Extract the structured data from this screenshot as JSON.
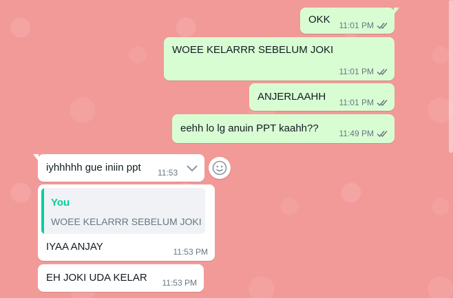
{
  "theme": {
    "wallpaper": "#f29a98",
    "outgoing_bubble": "#d9fdd3",
    "incoming_bubble": "#ffffff",
    "quote_accent": "#06cf9c",
    "tick_color": "#667781"
  },
  "messages": [
    {
      "direction": "outgoing",
      "text": "OKK",
      "time": "11:01 PM",
      "status": "double-check-icon"
    },
    {
      "direction": "outgoing",
      "text": "WOEE KELARRR SEBELUM JOKI",
      "time": "11:01 PM",
      "status": "double-check-icon"
    },
    {
      "direction": "outgoing",
      "text": "ANJERLAAHH",
      "time": "11:01 PM",
      "status": "double-check-icon"
    },
    {
      "direction": "outgoing",
      "text": "eehh lo lg anuin PPT kaahh??",
      "time": "11:49 PM",
      "status": "double-check-icon"
    },
    {
      "direction": "incoming",
      "text": "iyhhhhh gue iniin ppt",
      "time": "11:53",
      "hover_menu": "chevron-down-icon"
    },
    {
      "direction": "incoming",
      "quote": {
        "author": "You",
        "text": "WOEE KELARRR SEBELUM JOKI"
      },
      "text": "IYAA ANJAY",
      "time": "11:53 PM"
    },
    {
      "direction": "incoming",
      "text": "EH JOKI UDA KELAR",
      "time": "11:53 PM"
    }
  ],
  "reaction_button": "smiley-icon"
}
